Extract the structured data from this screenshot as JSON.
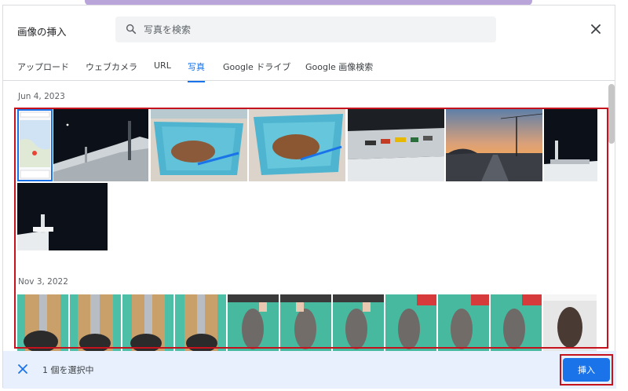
{
  "dialog": {
    "title": "画像の挿入",
    "search_placeholder": "写真を検索"
  },
  "tabs": [
    {
      "label": "アップロード"
    },
    {
      "label": "ウェブカメラ"
    },
    {
      "label": "URL"
    },
    {
      "label": "写真"
    },
    {
      "label": "Google ドライブ"
    },
    {
      "label": "Google 画像検索"
    }
  ],
  "active_tab": "写真",
  "sections": [
    {
      "date": "Jun 4, 2023"
    },
    {
      "date": "Nov 3, 2022"
    }
  ],
  "footer": {
    "selected_text": "1 個を選択中",
    "insert_label": "挿入"
  },
  "colors": {
    "accent": "#1a73e8",
    "highlight": "#c5121c"
  }
}
